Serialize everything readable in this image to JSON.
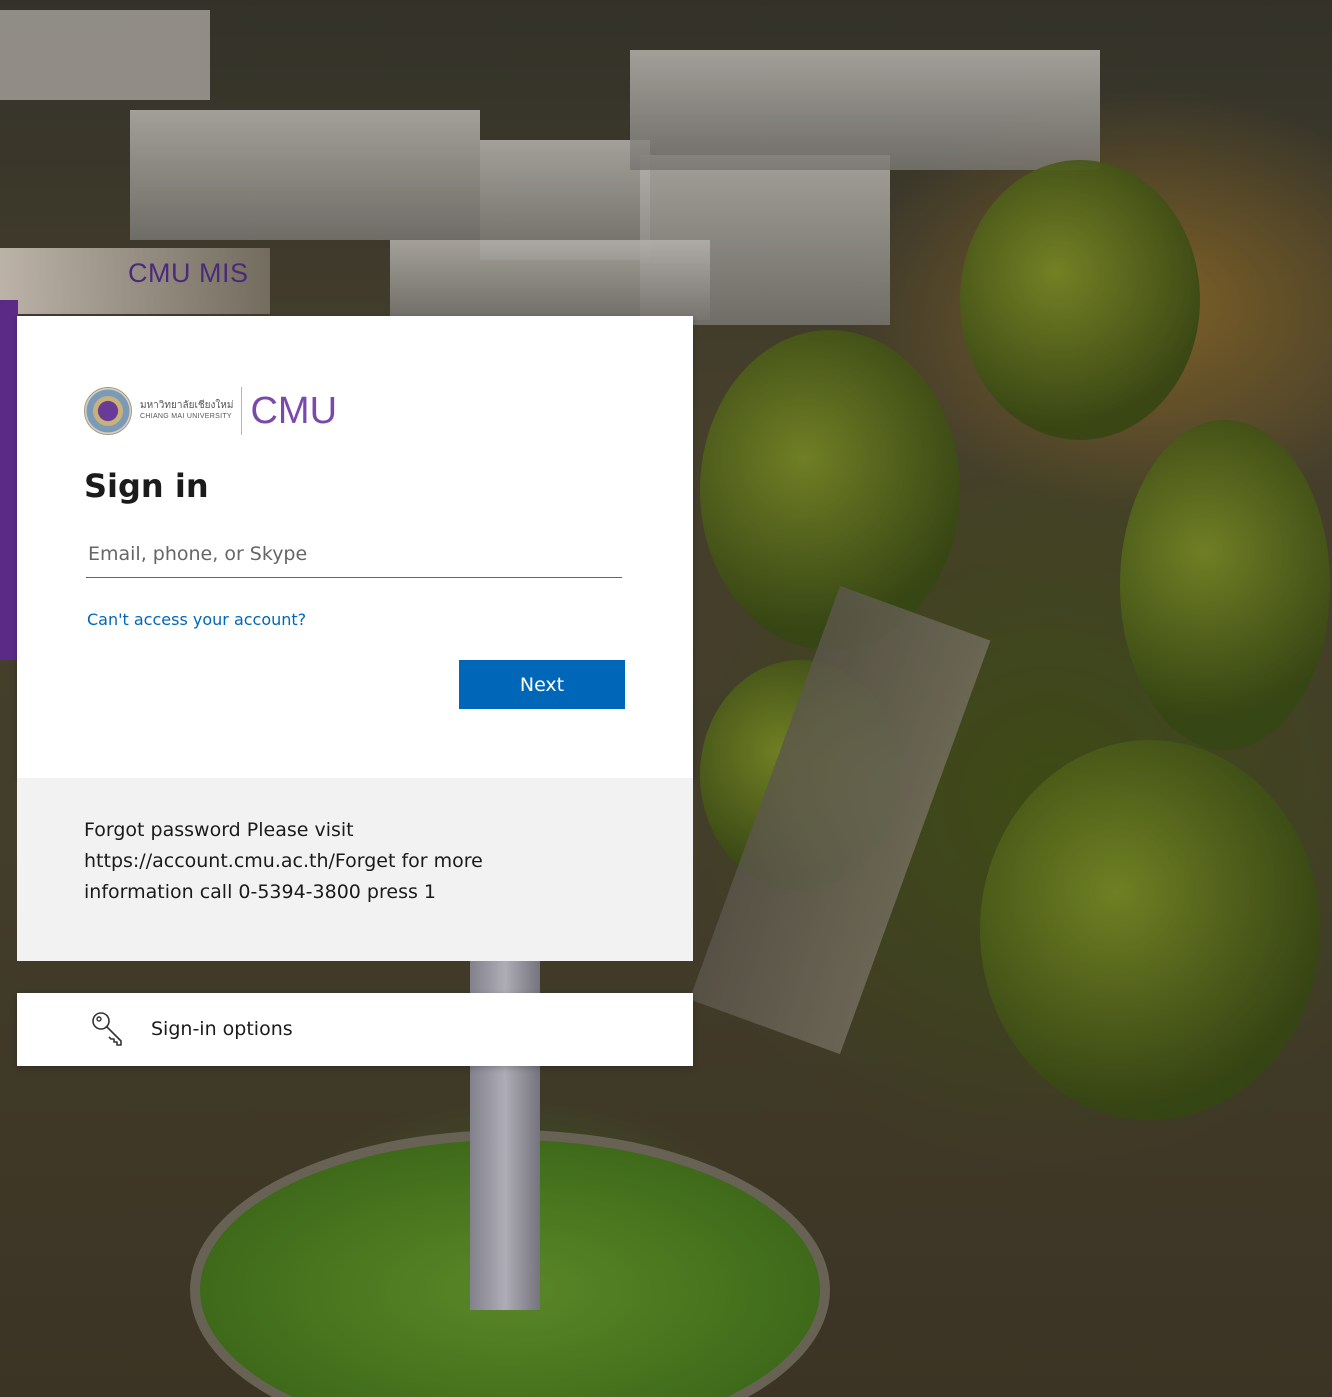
{
  "background": {
    "label": "CMU MIS"
  },
  "brand": {
    "thai_name": "มหาวิทยาลัยเชียงใหม่",
    "english_name": "CHIANG MAI UNIVERSITY",
    "short_name": "CMU"
  },
  "signin": {
    "title": "Sign in",
    "email_placeholder": "Email, phone, or Skype",
    "email_value": "",
    "cant_access_label": "Can't access your account?",
    "next_label": "Next"
  },
  "footer": {
    "line1": "Forgot password Please visit",
    "line2": "https://account.cmu.ac.th/Forget for more",
    "line3": "information call 0-5394-3800 press 1"
  },
  "options": {
    "label": "Sign-in options",
    "icon": "key-icon"
  },
  "colors": {
    "accent": "#0067b8",
    "brand_purple": "#7a4aab"
  }
}
